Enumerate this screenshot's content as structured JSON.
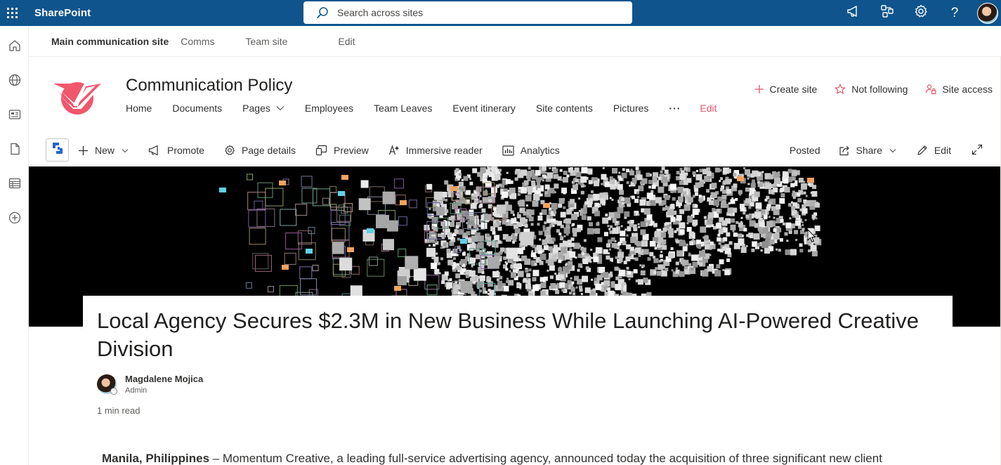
{
  "suite": {
    "brand": "SharePoint",
    "search_placeholder": "Search across sites",
    "icons": [
      "megaphone-icon",
      "network-icon",
      "gear-icon",
      "help-icon"
    ],
    "help_glyph": "?"
  },
  "appbar": {
    "icons": [
      "home-icon",
      "globe-icon",
      "news-icon",
      "document-icon",
      "list-icon",
      "add-circle-icon"
    ]
  },
  "hubnav": {
    "title": "Main communication site",
    "links": [
      "Comms",
      "Team site",
      "Edit"
    ]
  },
  "site": {
    "title": "Communication Policy",
    "brand_color": "#f0566c",
    "nav": [
      {
        "label": "Home"
      },
      {
        "label": "Documents"
      },
      {
        "label": "Pages",
        "dropdown": true
      },
      {
        "label": "Employees"
      },
      {
        "label": "Team Leaves"
      },
      {
        "label": "Event itinerary"
      },
      {
        "label": "Site contents"
      },
      {
        "label": "Pictures"
      }
    ],
    "nav_more": "···",
    "nav_edit": "Edit",
    "actions": {
      "create_site": "Create site",
      "follow": "Not following",
      "site_access": "Site access"
    }
  },
  "commandbar": {
    "new": "New",
    "promote": "Promote",
    "page_details": "Page details",
    "preview": "Preview",
    "immersive_reader": "Immersive reader",
    "analytics": "Analytics",
    "status": "Posted",
    "share": "Share",
    "edit": "Edit"
  },
  "article": {
    "title": "Local Agency Secures $2.3M in New Business While Launching AI-Powered Creative Division",
    "author_name": "Magdalene Mojica",
    "author_role": "Admin",
    "read_time": "1 min read",
    "dateline": "Manila, Philippines",
    "body_start": " – Momentum Creative, a leading full-service advertising agency, announced today the acquisition of three significant new client"
  },
  "colors": {
    "suite_bar": "#0f548c",
    "accent_edit": "#e0576b",
    "banner_bg": "#000000"
  }
}
